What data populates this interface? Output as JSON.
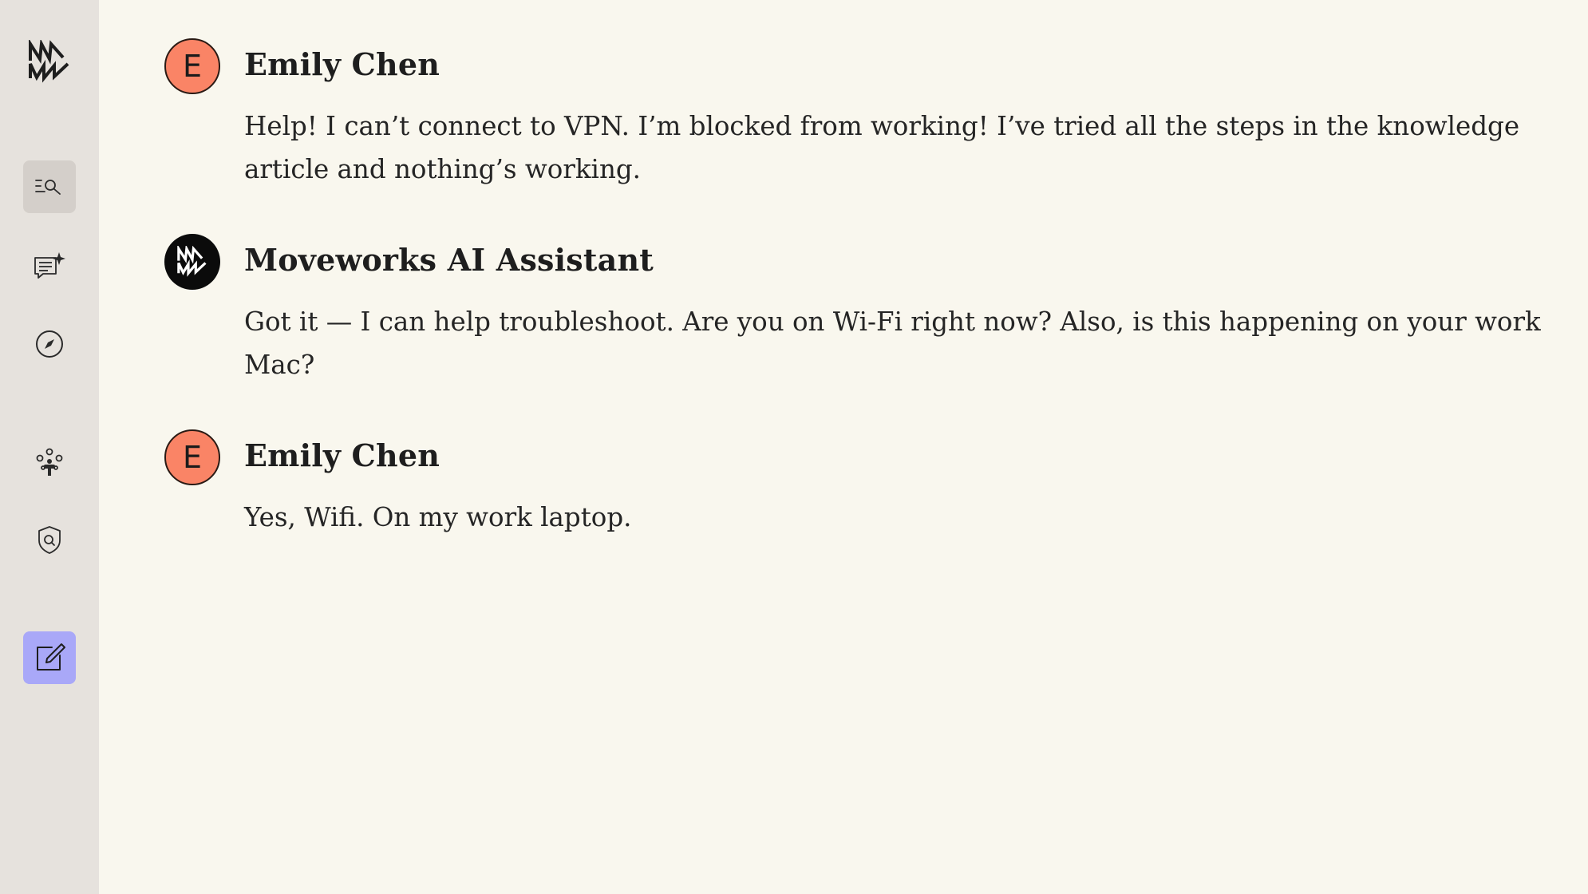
{
  "app": {
    "brand_icon": "moveworks-logo-icon"
  },
  "sidebar": {
    "items": [
      {
        "icon": "search-list-icon",
        "state": "active"
      },
      {
        "icon": "chat-sparkle-icon",
        "state": "default"
      },
      {
        "icon": "compass-icon",
        "state": "default"
      },
      {
        "icon": "people-network-icon",
        "state": "default"
      },
      {
        "icon": "shield-search-icon",
        "state": "default"
      },
      {
        "icon": "edit-compose-icon",
        "state": "highlighted"
      }
    ],
    "active_color": "#d4cfca",
    "compose_color": "#a9a8f8"
  },
  "conversation": {
    "messages": [
      {
        "sender": "Emily Chen",
        "avatar_letter": "E",
        "avatar_type": "user",
        "text": "Help! I can’t connect to VPN. I’m blocked from working! I’ve tried all the steps in the knowledge article and nothing’s working."
      },
      {
        "sender": "Moveworks AI Assistant",
        "avatar_letter": "",
        "avatar_type": "bot",
        "text": "Got it — I can help troubleshoot. Are you on Wi-Fi right now? Also, is this happening on your work Mac?"
      },
      {
        "sender": "Emily Chen",
        "avatar_letter": "E",
        "avatar_type": "user",
        "text": "Yes, Wifi. On my work laptop."
      }
    ]
  },
  "colors": {
    "background": "#f9f7ee",
    "sidebar": "#e6e2dd",
    "user_avatar": "#fa8466",
    "bot_avatar": "#0b0b0b"
  }
}
